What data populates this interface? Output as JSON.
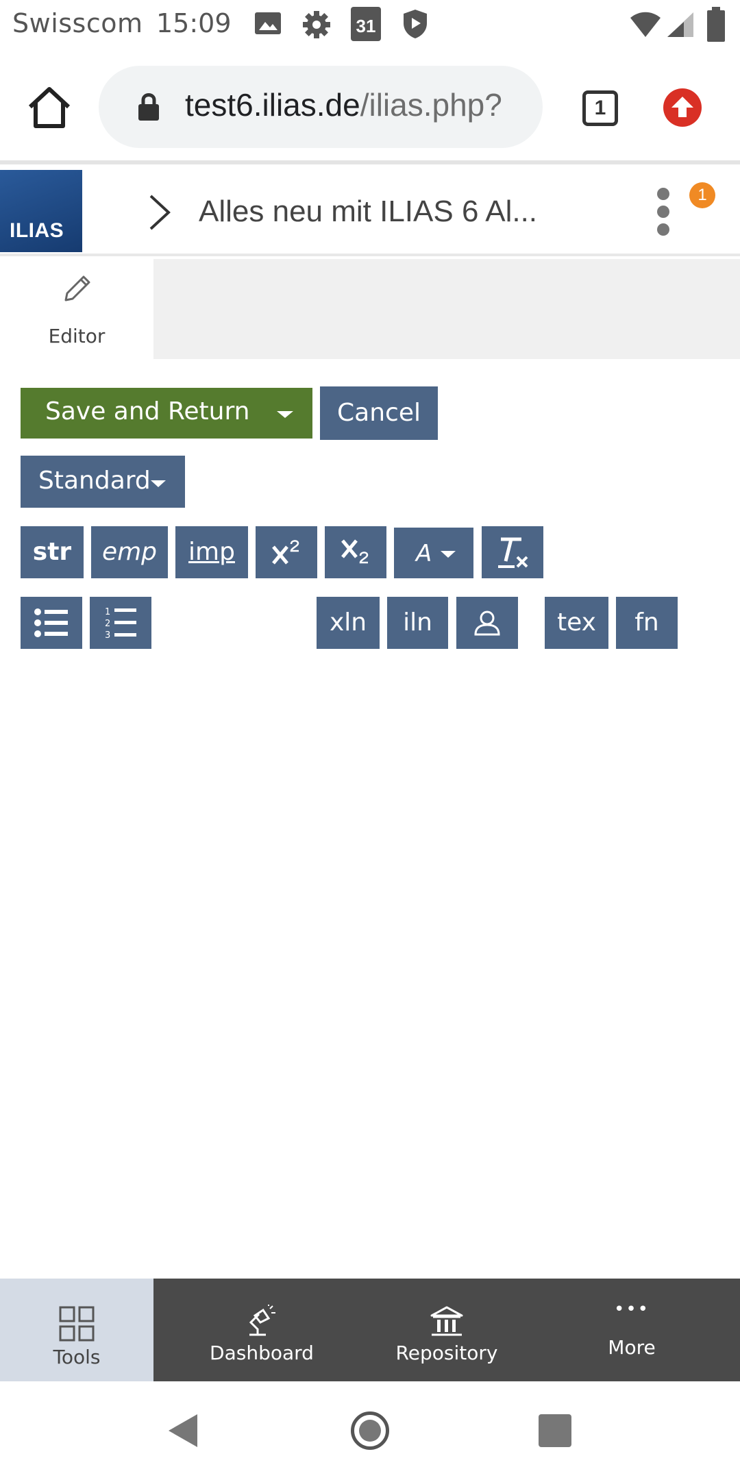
{
  "status_bar": {
    "carrier": "Swisscom",
    "time": "15:09",
    "calendar_day": "31",
    "icons": [
      "image-icon",
      "settings-icon",
      "calendar-icon",
      "shield-icon",
      "wifi-icon",
      "signal-icon",
      "battery-icon"
    ]
  },
  "browser": {
    "url_host": "test6.ilias.de",
    "url_path": "/ilias.php?",
    "tab_count": "1"
  },
  "header": {
    "logo_text": "ILIAS",
    "title": "Alles neu mit ILIAS 6 Al...",
    "notification_count": "1"
  },
  "tool_tab": {
    "label": "Editor"
  },
  "actions": {
    "save_label": "Save and Return",
    "cancel_label": "Cancel",
    "style_label": "Standard"
  },
  "toolbar": {
    "str": "str",
    "emp": "emp",
    "imp": "imp",
    "font": "A",
    "xln": "xln",
    "iln": "iln",
    "tex": "tex",
    "fn": "fn"
  },
  "bottom_nav": {
    "tools": "Tools",
    "dashboard": "Dashboard",
    "repository": "Repository",
    "more": "More",
    "more_glyph": "•••"
  },
  "colors": {
    "toolbar_blue": "#4c6586",
    "save_green": "#557b2e",
    "badge_orange": "#f08a24",
    "bottom_nav_bg": "#4a4a4a",
    "tools_active_bg": "#d4dbe5"
  }
}
